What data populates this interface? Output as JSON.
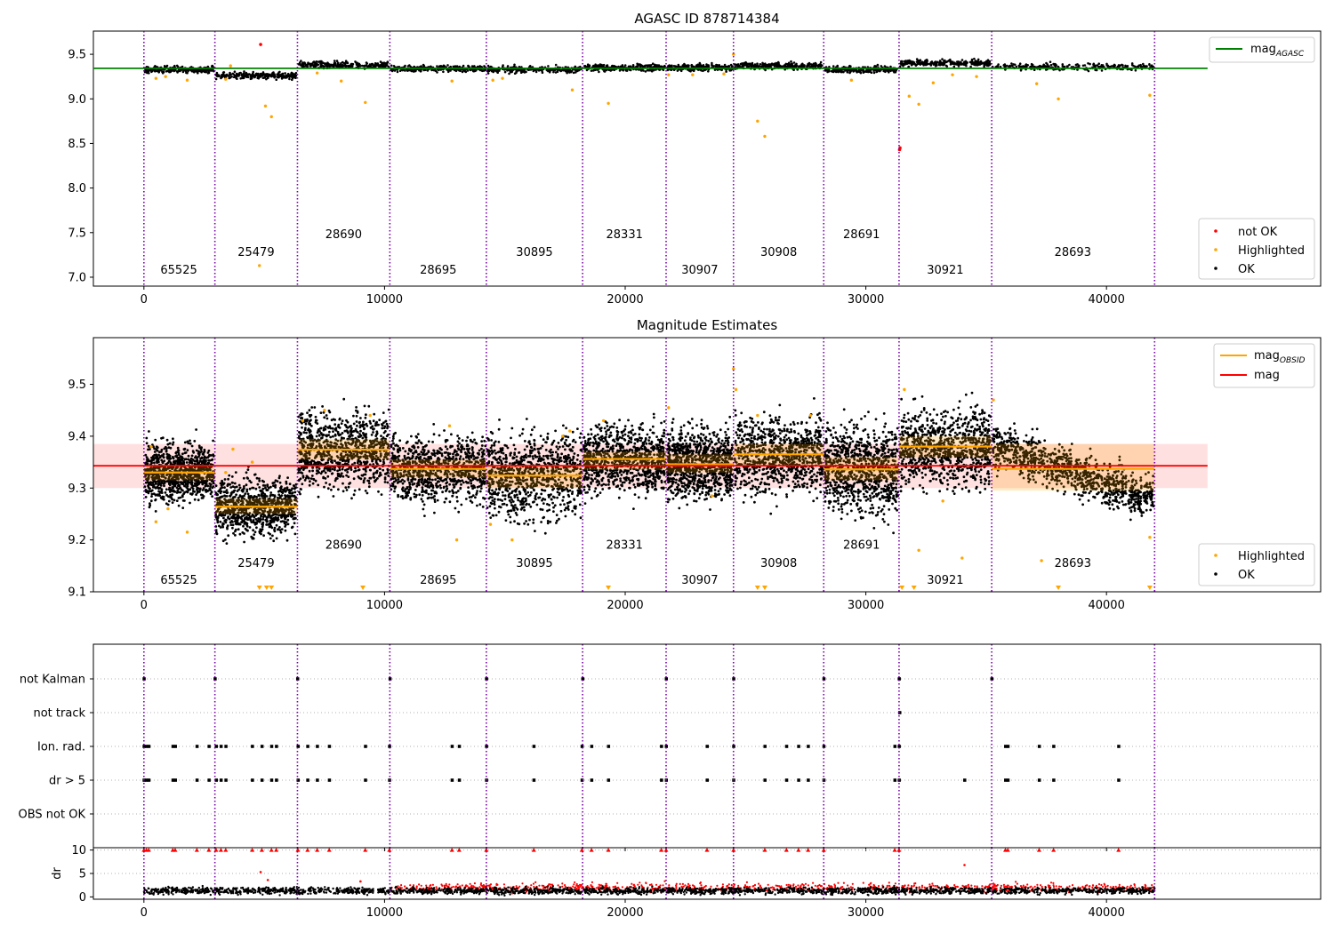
{
  "chart_data": [
    {
      "type": "scatter",
      "title": "AGASC ID 878714384",
      "xlim": [
        -2100,
        48900
      ],
      "ylim": [
        6.9,
        9.76
      ],
      "xticks": [
        0,
        10000,
        20000,
        30000,
        40000
      ],
      "xtick_labels": [
        "0",
        "10000",
        "20000",
        "30000",
        "40000"
      ],
      "yticks": [
        7.0,
        7.5,
        8.0,
        8.5,
        9.0,
        9.5
      ],
      "ytick_labels": [
        "7.0",
        "7.5",
        "8.0",
        "8.5",
        "9.0",
        "9.5"
      ],
      "obs_boundaries": [
        0,
        2950,
        6380,
        10220,
        14230,
        18230,
        21700,
        24500,
        28250,
        31380,
        35230,
        42000
      ],
      "obsid_labels": [
        {
          "text": "65525",
          "x": 1450,
          "y": 7.04
        },
        {
          "text": "25479",
          "x": 4660,
          "y": 7.24
        },
        {
          "text": "28690",
          "x": 8300,
          "y": 7.44
        },
        {
          "text": "28695",
          "x": 12230,
          "y": 7.04
        },
        {
          "text": "30895",
          "x": 16230,
          "y": 7.24
        },
        {
          "text": "28331",
          "x": 19970,
          "y": 7.44
        },
        {
          "text": "30907",
          "x": 23100,
          "y": 7.04
        },
        {
          "text": "30908",
          "x": 26380,
          "y": 7.24
        },
        {
          "text": "28691",
          "x": 29820,
          "y": 7.44
        },
        {
          "text": "30921",
          "x": 33300,
          "y": 7.04
        },
        {
          "text": "28693",
          "x": 38600,
          "y": 7.24
        }
      ],
      "agasc_mag": 9.343,
      "agasc_line_x": [
        -2100,
        44200
      ],
      "segment_levels": [
        9.33,
        9.26,
        9.38,
        9.34,
        9.33,
        9.35,
        9.35,
        9.37,
        9.33,
        9.4,
        9.36
      ],
      "segment_spread": 0.018,
      "series": [
        {
          "name": "not OK",
          "color": "#ff0000",
          "points": [
            [
              4850,
              9.61
            ],
            [
              31400,
              8.43
            ],
            [
              31420,
              8.45
            ]
          ]
        },
        {
          "name": "Highlighted",
          "color": "#ffa500",
          "points": [
            [
              500,
              9.23
            ],
            [
              900,
              9.25
            ],
            [
              1800,
              9.21
            ],
            [
              3400,
              9.22
            ],
            [
              3600,
              9.37
            ],
            [
              4800,
              7.13
            ],
            [
              5050,
              8.92
            ],
            [
              5300,
              8.8
            ],
            [
              7200,
              9.29
            ],
            [
              8200,
              9.2
            ],
            [
              9200,
              8.96
            ],
            [
              12800,
              9.2
            ],
            [
              14500,
              9.21
            ],
            [
              14900,
              9.23
            ],
            [
              17800,
              9.1
            ],
            [
              19300,
              8.95
            ],
            [
              21800,
              9.27
            ],
            [
              22800,
              9.27
            ],
            [
              24100,
              9.28
            ],
            [
              24500,
              9.5
            ],
            [
              25500,
              8.75
            ],
            [
              25800,
              8.58
            ],
            [
              29400,
              9.21
            ],
            [
              31800,
              9.03
            ],
            [
              32200,
              8.94
            ],
            [
              32800,
              9.18
            ],
            [
              33600,
              9.27
            ],
            [
              34600,
              9.25
            ],
            [
              37100,
              9.17
            ],
            [
              38000,
              9.0
            ],
            [
              41800,
              9.04
            ]
          ]
        },
        {
          "name": "OK",
          "color": "#000000",
          "sample_note": "dense black points around segment_levels"
        }
      ],
      "legend_main": {
        "entries": [
          {
            "label": "mag",
            "sub": "AGASC",
            "color": "#008000",
            "kind": "line"
          }
        ],
        "placement": "upper right"
      },
      "legend_points": {
        "entries": [
          {
            "label": "not OK",
            "color": "#ff0000"
          },
          {
            "label": "Highlighted",
            "color": "#ffa500"
          },
          {
            "label": "OK",
            "color": "#000000"
          }
        ],
        "placement": "lower right"
      }
    },
    {
      "type": "scatter",
      "title": "Magnitude Estimates",
      "xlim": [
        -2100,
        48900
      ],
      "ylim": [
        9.1,
        9.59
      ],
      "xticks": [
        0,
        10000,
        20000,
        30000,
        40000
      ],
      "xtick_labels": [
        "0",
        "10000",
        "20000",
        "30000",
        "40000"
      ],
      "yticks": [
        9.1,
        9.2,
        9.3,
        9.4,
        9.5
      ],
      "ytick_labels": [
        "9.1",
        "9.2",
        "9.3",
        "9.4",
        "9.5"
      ],
      "obs_boundaries": [
        0,
        2950,
        6380,
        10220,
        14230,
        18230,
        21700,
        24500,
        28250,
        31380,
        35230,
        42000
      ],
      "obsid_labels": [
        {
          "text": "65525",
          "x": 1450,
          "y": 9.115
        },
        {
          "text": "25479",
          "x": 4660,
          "y": 9.148
        },
        {
          "text": "28690",
          "x": 8300,
          "y": 9.183
        },
        {
          "text": "28695",
          "x": 12230,
          "y": 9.115
        },
        {
          "text": "30895",
          "x": 16230,
          "y": 9.148
        },
        {
          "text": "28331",
          "x": 19970,
          "y": 9.183
        },
        {
          "text": "30907",
          "x": 23100,
          "y": 9.115
        },
        {
          "text": "30908",
          "x": 26380,
          "y": 9.148
        },
        {
          "text": "28691",
          "x": 29820,
          "y": 9.183
        },
        {
          "text": "30921",
          "x": 33300,
          "y": 9.115
        },
        {
          "text": "28693",
          "x": 38600,
          "y": 9.148
        }
      ],
      "mag": 9.343,
      "mag_band": [
        9.3,
        9.385
      ],
      "mag_line_x": [
        -2100,
        44200
      ],
      "obs_mags": [
        9.33,
        9.264,
        9.374,
        9.337,
        9.324,
        9.356,
        9.346,
        9.365,
        9.336,
        9.38,
        9.337
      ],
      "obs_bands": [
        [
          9.315,
          9.345
        ],
        [
          9.25,
          9.28
        ],
        [
          9.355,
          9.395
        ],
        [
          9.32,
          9.355
        ],
        [
          9.3,
          9.345
        ],
        [
          9.335,
          9.37
        ],
        [
          9.33,
          9.365
        ],
        [
          9.345,
          9.385
        ],
        [
          9.315,
          9.36
        ],
        [
          9.36,
          9.4
        ],
        [
          9.295,
          9.385
        ]
      ],
      "highlighted": [
        [
          300,
          9.38
        ],
        [
          500,
          9.235
        ],
        [
          1000,
          9.26
        ],
        [
          1800,
          9.215
        ],
        [
          3400,
          9.33
        ],
        [
          3700,
          9.375
        ],
        [
          4500,
          9.35
        ],
        [
          6600,
          9.43
        ],
        [
          7500,
          9.45
        ],
        [
          9400,
          9.44
        ],
        [
          12700,
          9.42
        ],
        [
          13000,
          9.2
        ],
        [
          14400,
          9.23
        ],
        [
          15300,
          9.2
        ],
        [
          17400,
          9.4
        ],
        [
          17700,
          9.41
        ],
        [
          19100,
          9.43
        ],
        [
          21800,
          9.455
        ],
        [
          23600,
          9.285
        ],
        [
          24500,
          9.53
        ],
        [
          24600,
          9.49
        ],
        [
          25500,
          9.44
        ],
        [
          27700,
          9.44
        ],
        [
          31600,
          9.49
        ],
        [
          32200,
          9.18
        ],
        [
          33200,
          9.275
        ],
        [
          34000,
          9.165
        ],
        [
          35300,
          9.47
        ],
        [
          37300,
          9.16
        ],
        [
          41800,
          9.205
        ]
      ],
      "clipped_low_x": [
        4800,
        5100,
        5300,
        9100,
        19300,
        25500,
        25800,
        31500,
        32000,
        38000,
        41800
      ],
      "legend_main": {
        "entries": [
          {
            "label": "mag",
            "sub": "OBSID",
            "color": "#ffa500",
            "kind": "line"
          },
          {
            "label": "mag",
            "sub": "",
            "color": "#ff0000",
            "kind": "line"
          }
        ],
        "placement": "upper right"
      },
      "legend_points": {
        "entries": [
          {
            "label": "Highlighted",
            "color": "#ffa500"
          },
          {
            "label": "OK",
            "color": "#000000"
          }
        ],
        "placement": "lower right"
      }
    },
    {
      "type": "scatter",
      "title": "",
      "xlim": [
        -2100,
        48900
      ],
      "yticks": [
        "not Kalman",
        "not track",
        "Ion. rad.",
        "dr > 5",
        "OBS not OK"
      ],
      "obs_boundaries": [
        0,
        2950,
        6380,
        10220,
        14230,
        18230,
        21700,
        24500,
        28250,
        31380,
        35230,
        42000
      ],
      "flags": {
        "not Kalman": [
          0,
          2950,
          6380,
          10220,
          14230,
          18230,
          21700,
          24500,
          28250,
          31380,
          35230
        ],
        "not track": [
          31400
        ],
        "Ion. rad.": [
          0,
          100,
          200,
          1200,
          1300,
          2200,
          2700,
          3000,
          3200,
          3400,
          4500,
          4900,
          5300,
          5500,
          6400,
          6800,
          7200,
          7700,
          9200,
          10200,
          12800,
          13100,
          14230,
          16200,
          18200,
          18600,
          19300,
          21500,
          21700,
          23400,
          24500,
          25800,
          26700,
          27200,
          27600,
          28250,
          31200,
          31380,
          35800,
          35900,
          37200,
          37800,
          40500
        ],
        "dr > 5": [
          0,
          100,
          200,
          1200,
          1300,
          2200,
          2700,
          3000,
          3200,
          3400,
          4500,
          4900,
          5300,
          5500,
          6400,
          6800,
          7200,
          7700,
          9200,
          10200,
          12800,
          13100,
          14230,
          16200,
          18200,
          18600,
          19300,
          21500,
          21700,
          23400,
          24500,
          25800,
          26700,
          27200,
          27600,
          28250,
          31200,
          31380,
          34100,
          35800,
          35900,
          37200,
          37800,
          40500
        ],
        "OBS not OK": []
      }
    },
    {
      "type": "scatter",
      "title": "",
      "ylabel": "dr",
      "xlim": [
        -2100,
        48900
      ],
      "ylim": [
        -0.5,
        10.5
      ],
      "xticks": [
        0,
        10000,
        20000,
        30000,
        40000
      ],
      "xtick_labels": [
        "0",
        "10000",
        "20000",
        "30000",
        "40000"
      ],
      "yticks": [
        0,
        5,
        10
      ],
      "ytick_labels": [
        "0",
        "5",
        "10"
      ],
      "clipped_at_10": [
        0,
        100,
        200,
        1200,
        1300,
        2200,
        2700,
        3000,
        3200,
        3400,
        4500,
        4900,
        5300,
        5500,
        6400,
        6800,
        7200,
        7700,
        9200,
        10200,
        12800,
        13100,
        14230,
        16200,
        18200,
        18600,
        19300,
        21500,
        21700,
        23400,
        24500,
        25800,
        26700,
        27200,
        27600,
        28250,
        31200,
        31380,
        35800,
        35900,
        37200,
        37800,
        40500
      ],
      "isolated": [
        [
          4850,
          5.3
        ],
        [
          5150,
          3.6
        ],
        [
          9000,
          3.3
        ],
        [
          34100,
          6.8
        ]
      ]
    }
  ]
}
